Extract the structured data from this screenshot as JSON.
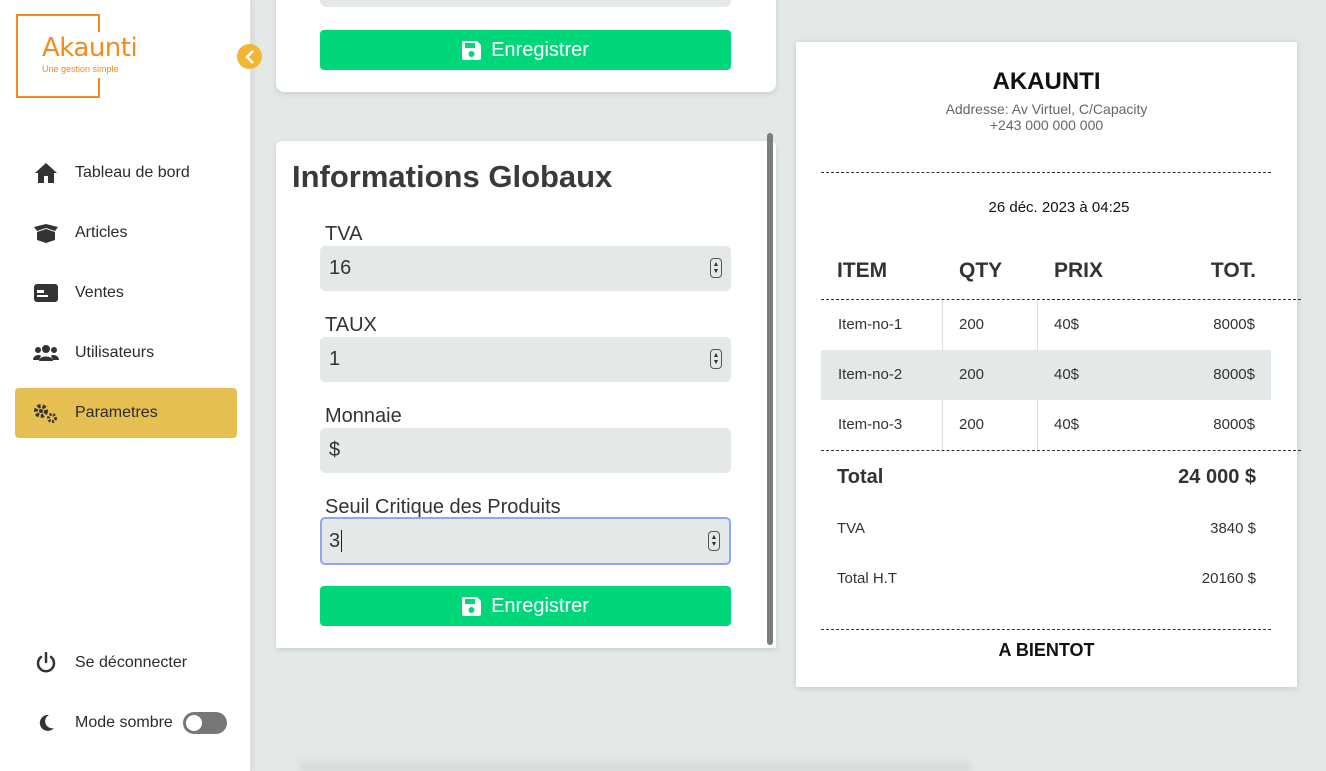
{
  "brand": {
    "name": "Akaunti",
    "tagline": "Une gestion simple",
    "color": "#f58a1f"
  },
  "sidebar": {
    "items": [
      {
        "label": "Tableau de bord",
        "icon": "home-icon"
      },
      {
        "label": "Articles",
        "icon": "box-icon"
      },
      {
        "label": "Ventes",
        "icon": "card-icon"
      },
      {
        "label": "Utilisateurs",
        "icon": "users-icon"
      },
      {
        "label": "Parametres",
        "icon": "gears-icon",
        "active": true
      }
    ],
    "logout_label": "Se déconnecter",
    "dark_mode_label": "Mode sombre",
    "dark_mode_on": false
  },
  "top_card": {
    "save_label": "Enregistrer"
  },
  "global_info": {
    "title": "Informations Globaux",
    "fields": [
      {
        "label": "TVA",
        "value": "16"
      },
      {
        "label": "TAUX",
        "value": "1"
      },
      {
        "label": "Monnaie",
        "value": "$"
      },
      {
        "label": "Seuil Critique des Produits",
        "value": "3"
      }
    ],
    "save_label": "Enregistrer"
  },
  "receipt": {
    "company": "AKAUNTI",
    "address": "Addresse: Av Virtuel, C/Capacity",
    "phone": "+243 000 000 000",
    "date": "26 déc. 2023 à 04:25",
    "headers": {
      "item": "ITEM",
      "qty": "QTY",
      "price": "PRIX",
      "total": "TOT."
    },
    "rows": [
      {
        "item": "Item-no-1",
        "qty": "200",
        "price": "40$",
        "total": "8000$"
      },
      {
        "item": "Item-no-2",
        "qty": "200",
        "price": "40$",
        "total": "8000$"
      },
      {
        "item": "Item-no-3",
        "qty": "200",
        "price": "40$",
        "total": "8000$"
      }
    ],
    "total_label": "Total",
    "total_value": "24 000 $",
    "tva_label": "TVA",
    "tva_value": "3840 $",
    "ht_label": "Total H.T",
    "ht_value": "20160 $",
    "footer": "A BIENTOT"
  },
  "colors": {
    "accent": "#e5bf52",
    "save_button": "#00d77a",
    "background": "#e4e9e7"
  }
}
